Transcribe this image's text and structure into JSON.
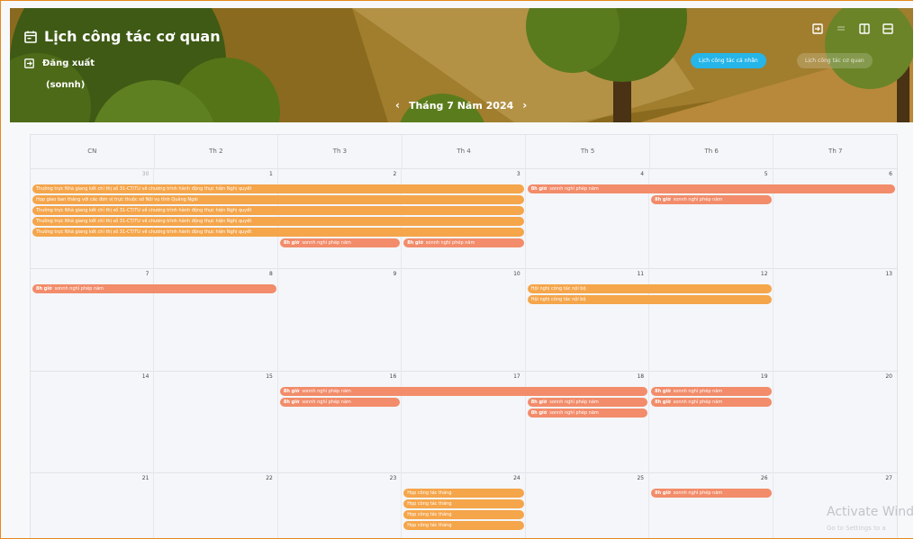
{
  "header": {
    "title": "Lịch công tác cơ quan",
    "logout_label": "Đăng xuất",
    "username": "(sonnh)",
    "month_label": "Tháng 7 Năm 2024",
    "btn_personal": "Lịch công tác cá nhân",
    "btn_org": "Lịch công tác cơ quan"
  },
  "weekdays": [
    "CN",
    "Th 2",
    "Th 3",
    "Th 4",
    "Th 5",
    "Th 6",
    "Th 7"
  ],
  "weeks": [
    {
      "days": [
        "30",
        "1",
        "2",
        "3",
        "4",
        "5",
        "6"
      ],
      "first_other": true,
      "events": [
        {
          "row": 0,
          "start": 0,
          "span": 4,
          "kind": "o",
          "text": "Thường trực Nhà giang kết chỉ thị số 31-CT/TU về chương trình hành động thực hiện Nghị quyết"
        },
        {
          "row": 1,
          "start": 0,
          "span": 4,
          "kind": "o",
          "text": "Họp giao ban tháng với các đơn vị trực thuộc sở Nội vụ tỉnh Quảng Ngãi"
        },
        {
          "row": 2,
          "start": 0,
          "span": 4,
          "kind": "o",
          "text": "Thường trực Nhà giang kết chỉ thị số 31-CT/TU về chương trình hành động thực hiện Nghị quyết"
        },
        {
          "row": 3,
          "start": 0,
          "span": 4,
          "kind": "o",
          "text": "Thường trực Nhà giang kết chỉ thị số 31-CT/TU về chương trình hành động thực hiện Nghị quyết"
        },
        {
          "row": 4,
          "start": 0,
          "span": 4,
          "kind": "o",
          "text": "Thường trực Nhà giang kết chỉ thị số 31-CT/TU về chương trình hành động thực hiện Nghị quyết"
        },
        {
          "row": 5,
          "start": 2,
          "span": 1,
          "kind": "s",
          "time": "8h giờ",
          "text": "sonnh nghỉ phép năm"
        },
        {
          "row": 5,
          "start": 3,
          "span": 1,
          "kind": "s",
          "time": "8h giờ",
          "text": "sonnh nghỉ phép năm"
        },
        {
          "row": 0,
          "start": 4,
          "span": 3,
          "kind": "s",
          "time": "8h giờ",
          "text": "sonnh nghỉ phép năm"
        },
        {
          "row": 1,
          "start": 5,
          "span": 1,
          "kind": "s",
          "time": "8h giờ",
          "text": "sonnh nghỉ phép năm"
        }
      ]
    },
    {
      "days": [
        "7",
        "8",
        "9",
        "10",
        "11",
        "12",
        "13"
      ],
      "events": [
        {
          "row": 0,
          "start": 0,
          "span": 2,
          "kind": "s",
          "time": "8h giờ",
          "text": "sonnh nghỉ phép năm"
        },
        {
          "row": 0,
          "start": 4,
          "span": 2,
          "kind": "o",
          "text": "Hội nghị công tác nội bộ"
        },
        {
          "row": 1,
          "start": 4,
          "span": 2,
          "kind": "o",
          "text": "Hội nghị công tác nội bộ"
        }
      ]
    },
    {
      "days": [
        "14",
        "15",
        "16",
        "17",
        "18",
        "19",
        "20"
      ],
      "events": [
        {
          "row": 0,
          "start": 2,
          "span": 3,
          "kind": "s",
          "time": "8h giờ",
          "text": "sonnh nghỉ phép năm"
        },
        {
          "row": 1,
          "start": 2,
          "span": 1,
          "kind": "s",
          "time": "8h giờ",
          "text": "sonnh nghỉ phép năm"
        },
        {
          "row": 1,
          "start": 4,
          "span": 1,
          "kind": "s",
          "time": "8h giờ",
          "text": "sonnh nghỉ phép năm"
        },
        {
          "row": 2,
          "start": 4,
          "span": 1,
          "kind": "s",
          "time": "8h giờ",
          "text": "sonnh nghỉ phép năm"
        },
        {
          "row": 0,
          "start": 5,
          "span": 1,
          "kind": "s",
          "time": "8h giờ",
          "text": "sonnh nghỉ phép năm"
        },
        {
          "row": 1,
          "start": 5,
          "span": 1,
          "kind": "s",
          "time": "8h giờ",
          "text": "sonnh nghỉ phép năm"
        }
      ]
    },
    {
      "days": [
        "21",
        "22",
        "23",
        "24",
        "25",
        "26",
        "27"
      ],
      "events": [
        {
          "row": 0,
          "start": 3,
          "span": 1,
          "kind": "o",
          "text": "Họp công tác tháng"
        },
        {
          "row": 1,
          "start": 3,
          "span": 1,
          "kind": "o",
          "text": "Họp công tác tháng"
        },
        {
          "row": 2,
          "start": 3,
          "span": 1,
          "kind": "o",
          "text": "Họp công tác tháng"
        },
        {
          "row": 3,
          "start": 3,
          "span": 1,
          "kind": "o",
          "text": "Họp công tác tháng"
        },
        {
          "row": 0,
          "start": 5,
          "span": 1,
          "kind": "s",
          "time": "8h giờ",
          "text": "sonnh nghỉ phép năm"
        }
      ]
    }
  ],
  "watermark": {
    "line1": "Activate Wind",
    "line2": "Go to Settings to a"
  }
}
